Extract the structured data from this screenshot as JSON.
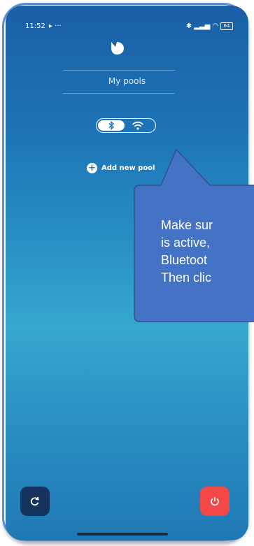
{
  "status_bar": {
    "time": "11:52",
    "extra": "▸ ···",
    "battery": "64"
  },
  "header": {
    "title": "My pools"
  },
  "connection": {
    "bluetooth_icon": "bluetooth-icon",
    "wifi_icon": "wifi-icon"
  },
  "actions": {
    "add_pool_label": "Add new pool"
  },
  "callout": {
    "text": "Make sur\nis active,\nBluetoot\nThen clic"
  },
  "bottom": {
    "refresh_icon": "refresh-icon",
    "power_icon": "power-icon"
  },
  "colors": {
    "accent": "#4472c4",
    "power": "#f44848",
    "refresh": "#16335d"
  }
}
